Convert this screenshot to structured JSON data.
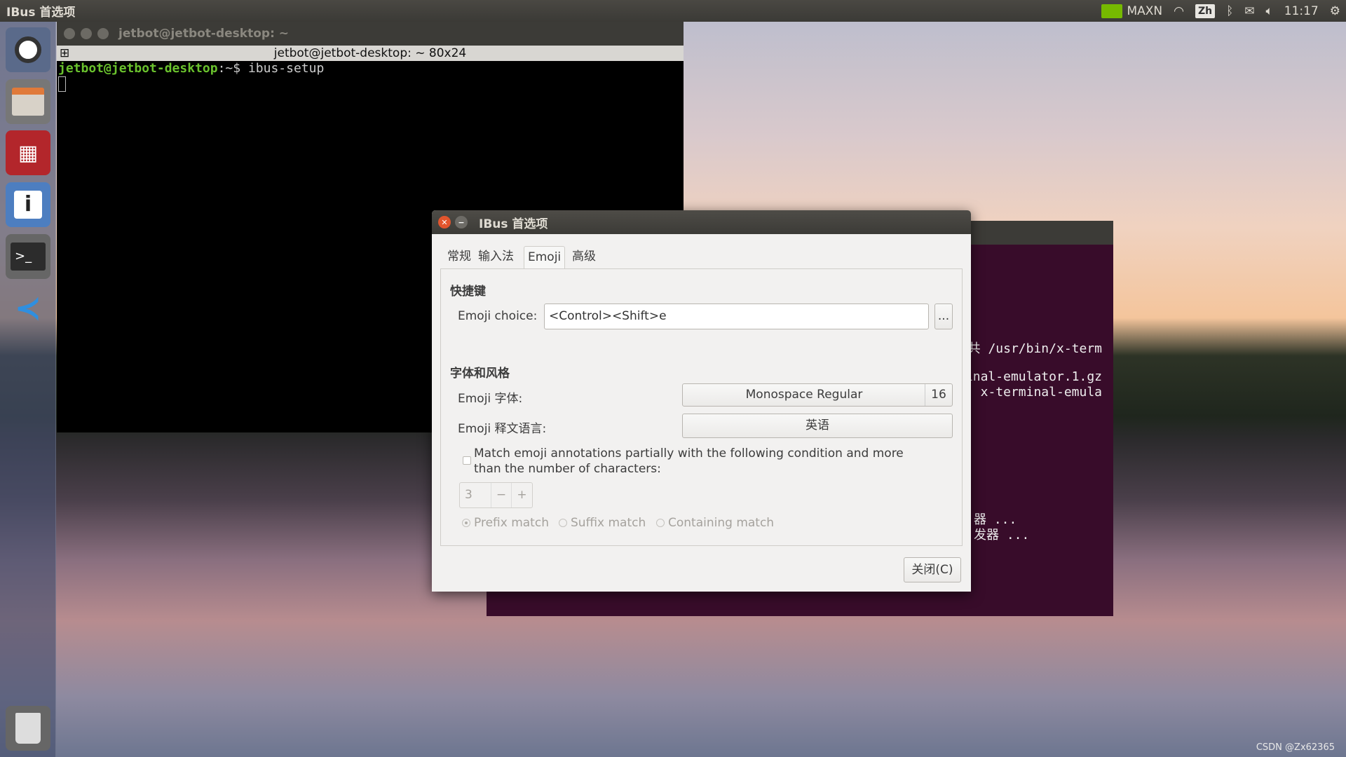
{
  "topbar": {
    "app_title": "IBus 首选项",
    "power_mode": "MAXN",
    "ime_indicator": "Zh",
    "time": "11:17",
    "icons": [
      "nvidia-icon",
      "wifi-icon",
      "bluetooth-icon",
      "mail-icon",
      "volume-icon",
      "gear-icon"
    ]
  },
  "launcher": {
    "items": [
      "ubuntu-dash",
      "files",
      "app-red",
      "system-info",
      "terminal",
      "vscode",
      "trash"
    ]
  },
  "terminal": {
    "title": "jetbot@jetbot-desktop: ~",
    "tab_title": "jetbot@jetbot-desktop: ~ 80x24",
    "prompt_user": "jetbot@jetbot-desktop",
    "prompt_path": ":~$ ",
    "command": "ibus-setup"
  },
  "terminal2": {
    "lines": [
      "共 /usr/bin/x-term",
      "inal-emulator.1.gz",
      "x-terminal-emula",
      "器 ...",
      "发器 ..."
    ]
  },
  "dialog": {
    "title": "IBus 首选项",
    "tabs": [
      {
        "label": "常规"
      },
      {
        "label": "输入法"
      },
      {
        "label": "Emoji",
        "active": true
      },
      {
        "label": "高级"
      }
    ],
    "shortcut_section": "快捷键",
    "emoji_choice_label": "Emoji choice:",
    "emoji_choice_value": "<Control><Shift>e",
    "emoji_choice_button": "...",
    "font_section": "字体和风格",
    "emoji_font_label": "Emoji 字体:",
    "emoji_font_value": "Monospace Regular",
    "emoji_font_size": "16",
    "emoji_lang_label": "Emoji 释文语言:",
    "emoji_lang_value": "英语",
    "partial_match_label": "Match emoji annotations partially with the following condition and more than the number of characters:",
    "partial_match_checked": false,
    "char_count": "3",
    "minus": "−",
    "plus": "+",
    "radios": [
      {
        "label": "Prefix match",
        "selected": true
      },
      {
        "label": "Suffix match",
        "selected": false
      },
      {
        "label": "Containing match",
        "selected": false
      }
    ],
    "close_button": "关闭(C)"
  },
  "watermark": "CSDN @Zx62365"
}
